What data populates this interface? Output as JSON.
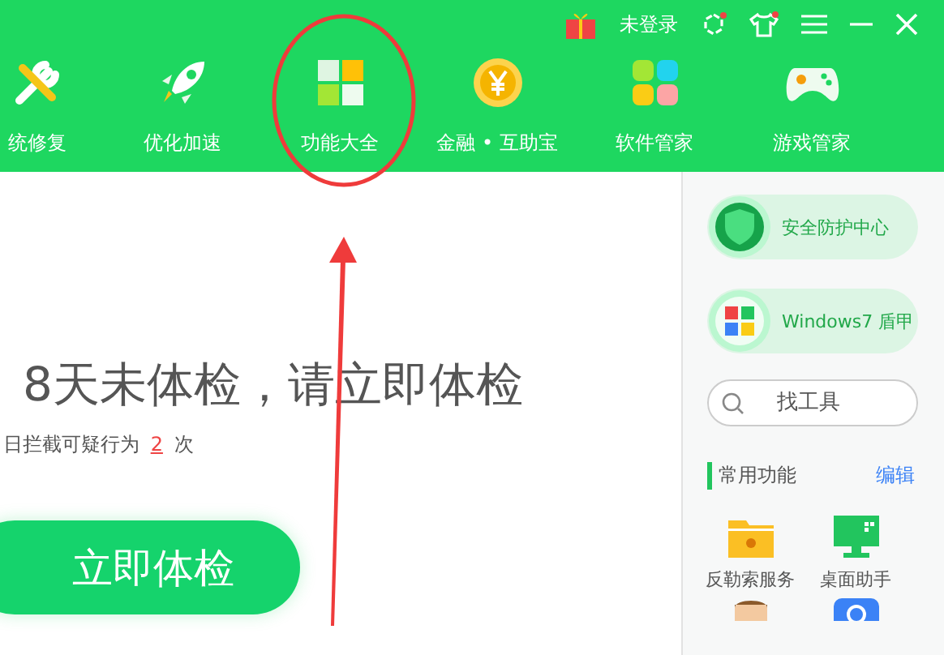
{
  "header": {
    "user": "未登录"
  },
  "nav": [
    {
      "label": "统修复",
      "kind": "repair"
    },
    {
      "label": "优化加速",
      "kind": "rocket"
    },
    {
      "label": "功能大全",
      "kind": "grid"
    },
    {
      "label": "金融 • 互助宝",
      "kind": "coin"
    },
    {
      "label": "软件管家",
      "kind": "apps"
    },
    {
      "label": "游戏管家",
      "kind": "gamepad"
    }
  ],
  "main": {
    "headline": "8天未体检，请立即体检",
    "subline": {
      "text": "日拦截可疑行为",
      "count": "2",
      "unit": "次"
    },
    "button": "立即体检"
  },
  "side": {
    "cards": [
      {
        "label": "安全防护中心",
        "kind": "shield"
      },
      {
        "label": "Windows7 盾甲",
        "kind": "windows"
      }
    ],
    "search": {
      "placeholder": "找工具"
    },
    "section": {
      "title": "常用功能",
      "action": "编辑"
    },
    "tools": [
      {
        "label": "反勒索服务",
        "kind": "folder"
      },
      {
        "label": "桌面助手",
        "kind": "monitor"
      },
      {
        "kind": "person"
      },
      {
        "kind": "badge"
      }
    ]
  }
}
